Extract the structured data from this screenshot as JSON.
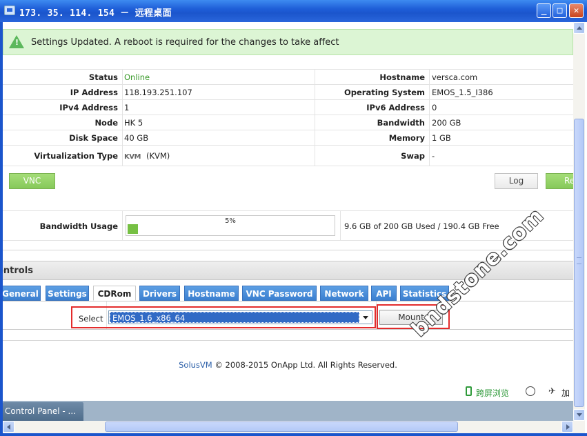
{
  "window": {
    "title": "173. 35. 114. 154 － 远程桌面",
    "minimize_glyph": "_",
    "maximize_glyph": "□",
    "close_glyph": "✕"
  },
  "alert": {
    "message": "Settings Updated. A reboot is required for the changes to take affect",
    "icon": "warning-icon",
    "color": "#dcf5d4"
  },
  "info": {
    "rows": [
      {
        "left_label": "Status",
        "left_value": "Online",
        "right_label": "Hostname",
        "right_value": "versca.com"
      },
      {
        "left_label": "IP Address",
        "left_value": "118.193.251.107",
        "right_label": "Operating System",
        "right_value": "EMOS_1.5_I386"
      },
      {
        "left_label": "IPv4 Address",
        "left_value": "1",
        "right_label": "IPv6 Address",
        "right_value": "0"
      },
      {
        "left_label": "Node",
        "left_value": "HK 5",
        "right_label": "Bandwidth",
        "right_value": "200 GB"
      },
      {
        "left_label": "Disk Space",
        "left_value": "40 GB",
        "right_label": "Memory",
        "right_value": "1 GB"
      },
      {
        "left_label": "Virtualization Type",
        "left_logo": "KVM",
        "left_value": "(KVM)",
        "right_label": "Swap",
        "right_value": "-"
      }
    ],
    "status_color": "#3a9a2a"
  },
  "actions": {
    "vnc": "VNC",
    "log": "Log",
    "reboot_partial": "Re"
  },
  "bandwidth": {
    "label": "Bandwidth Usage",
    "percent_text": "5%",
    "percent": 5,
    "summary": "9.6 GB of 200 GB Used / 190.4 GB Free"
  },
  "controls": {
    "title": "ontrols",
    "tabs": [
      "General",
      "Settings",
      "CDRom",
      "Drivers",
      "Hostname",
      "VNC Password",
      "Network",
      "API",
      "Statistics"
    ],
    "active_tab": "CDRom",
    "select_label": "Select",
    "select_value": "EMOS_1.6_x86_64",
    "mount_label": "Mount"
  },
  "footer": {
    "brand": "SolusVM",
    "rest": " © 2008-2015 OnApp Ltd. All Rights Reserved."
  },
  "statusbar": {
    "cross_screen": "跨屏浏览",
    "accelerate": "加"
  },
  "taskbar": {
    "item": "Control Panel - ..."
  },
  "watermark": "bndstone.com"
}
